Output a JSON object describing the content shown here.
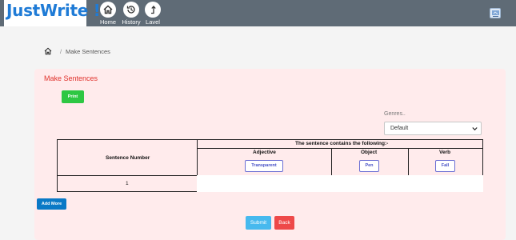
{
  "app": {
    "brand": "JustWrite !",
    "colors": {
      "brand_blue": "#1f7bd6",
      "topbar": "#5f6b76",
      "panel_bg": "#ffebec",
      "title_red": "#e0312b"
    }
  },
  "nav": {
    "items": [
      {
        "label": "Home",
        "icon": "home-icon"
      },
      {
        "label": "History",
        "icon": "history-icon"
      },
      {
        "label": "Lavel",
        "icon": "level-up-icon"
      }
    ],
    "right_icon": "app-icon"
  },
  "breadcrumb": {
    "separator": "/",
    "current": "Make Sentences"
  },
  "page": {
    "title": "Make Sentences",
    "print_label": "Print",
    "genres": {
      "label": "Genres..",
      "selected": "Default"
    },
    "table": {
      "sentence_number_header": "Sentence Number",
      "group_header": "The sentence contains the following:-",
      "columns": [
        {
          "header": "Adjective",
          "word": "Transparent"
        },
        {
          "header": "Object",
          "word": "Pen"
        },
        {
          "header": "Verb",
          "word": "Fall"
        }
      ],
      "rows": [
        {
          "number": "1"
        }
      ]
    },
    "add_more_label": "Add More",
    "submit_label": "Submit",
    "back_label": "Back"
  }
}
